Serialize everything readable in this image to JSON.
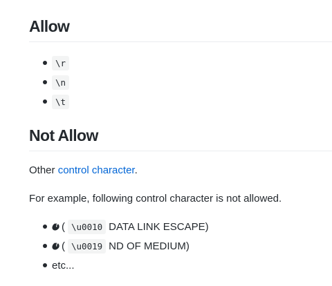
{
  "sections": {
    "allow": {
      "heading": "Allow",
      "items": [
        "\\r",
        "\\n",
        "\\t"
      ]
    },
    "not_allow": {
      "heading": "Not Allow",
      "paragraph1_prefix": "Other ",
      "paragraph1_link": "control character",
      "paragraph1_suffix": ".",
      "paragraph2": "For example, following control character is not allowed.",
      "items": [
        {
          "open": "(",
          "code": "\\u0010",
          "desc": "DATA LINK ESCAPE)"
        },
        {
          "open": "(",
          "code": "\\u0019",
          "desc": "ND OF MEDIUM)"
        }
      ],
      "etc": "etc..."
    }
  },
  "colors": {
    "text": "#24292e",
    "link": "#0366d6",
    "code_bg": "#f3f4f4",
    "rule": "#eaecef"
  },
  "icons": {
    "replacement_char": "replacement-character-icon",
    "bullet": "bullet-icon"
  }
}
